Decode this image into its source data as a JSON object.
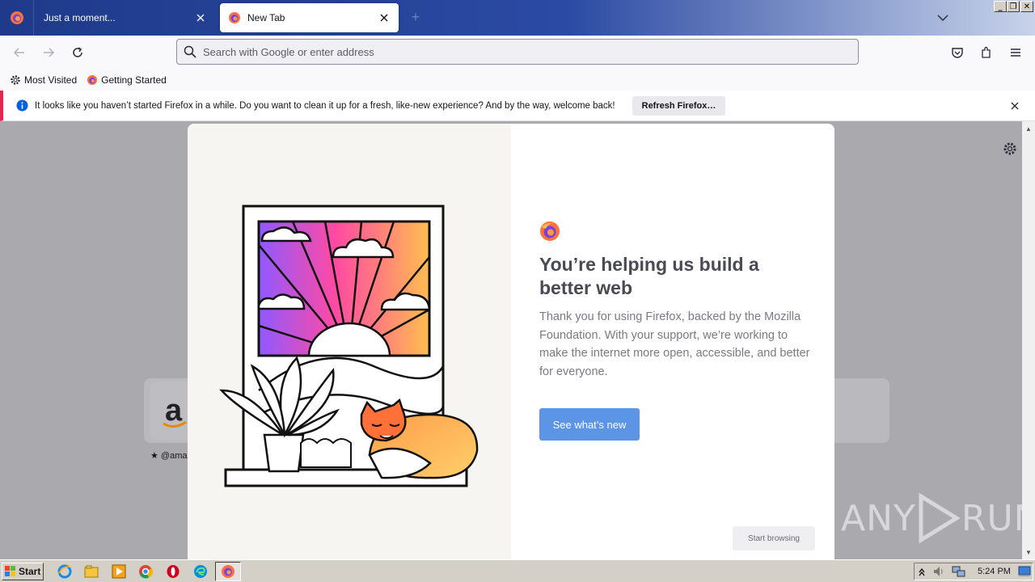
{
  "browser": {
    "tabs": [
      {
        "title": "Just a moment...",
        "active": false
      },
      {
        "title": "New Tab",
        "active": true
      }
    ],
    "window_controls": {
      "minimize": "_",
      "restore": "❐",
      "close": "✕"
    }
  },
  "navbar": {
    "url_placeholder": "Search with Google or enter address"
  },
  "bookmarks": [
    {
      "label": "Most Visited",
      "icon": "gear-icon"
    },
    {
      "label": "Getting Started",
      "icon": "firefox-icon"
    }
  ],
  "notification": {
    "message": "It looks like you haven’t started Firefox in a while. Do you want to clean it up for a fresh, like-new experience? And by the way, welcome back!",
    "action_label": "Refresh Firefox…"
  },
  "background": {
    "amazon_label": "★ @ama"
  },
  "modal": {
    "headline": "You’re helping us build a better web",
    "body": "Thank you for using Firefox, backed by the Mozilla Foundation. With your support, we’re working to make the internet more open, accessible, and better for everyone.",
    "primary_button": "See what’s new",
    "secondary_button": "Start browsing"
  },
  "watermark": {
    "text_left": "ANY",
    "text_right": "RUN"
  },
  "taskbar": {
    "start_label": "Start",
    "clock": "5:24 PM",
    "pinned": [
      "ie-icon",
      "explorer-icon",
      "media-player-icon",
      "chrome-icon",
      "opera-icon",
      "edge-icon",
      "firefox-icon"
    ]
  },
  "colors": {
    "accent_blue": "#5c95e6",
    "notification_bar": "#e22850",
    "tabstrip": "#1f3a8a"
  }
}
